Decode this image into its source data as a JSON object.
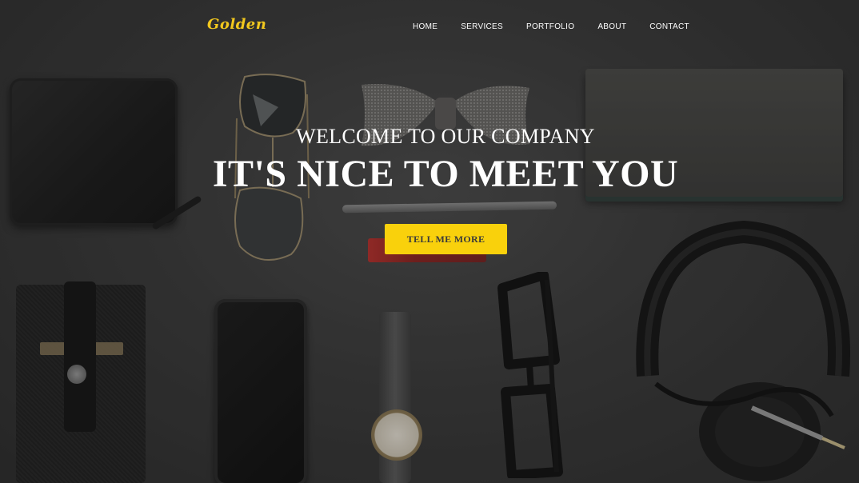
{
  "brand": {
    "name": "Golden",
    "color": "#f2c81e"
  },
  "nav": {
    "items": [
      {
        "label": "HOME"
      },
      {
        "label": "SERVICES"
      },
      {
        "label": "PORTFOLIO"
      },
      {
        "label": "ABOUT"
      },
      {
        "label": "CONTACT"
      }
    ]
  },
  "hero": {
    "subheading": "WELCOME TO OUR COMPANY",
    "heading": "IT'S NICE TO MEET YOU",
    "cta_label": "TELL ME MORE",
    "cta_color": "#f9d10c"
  }
}
